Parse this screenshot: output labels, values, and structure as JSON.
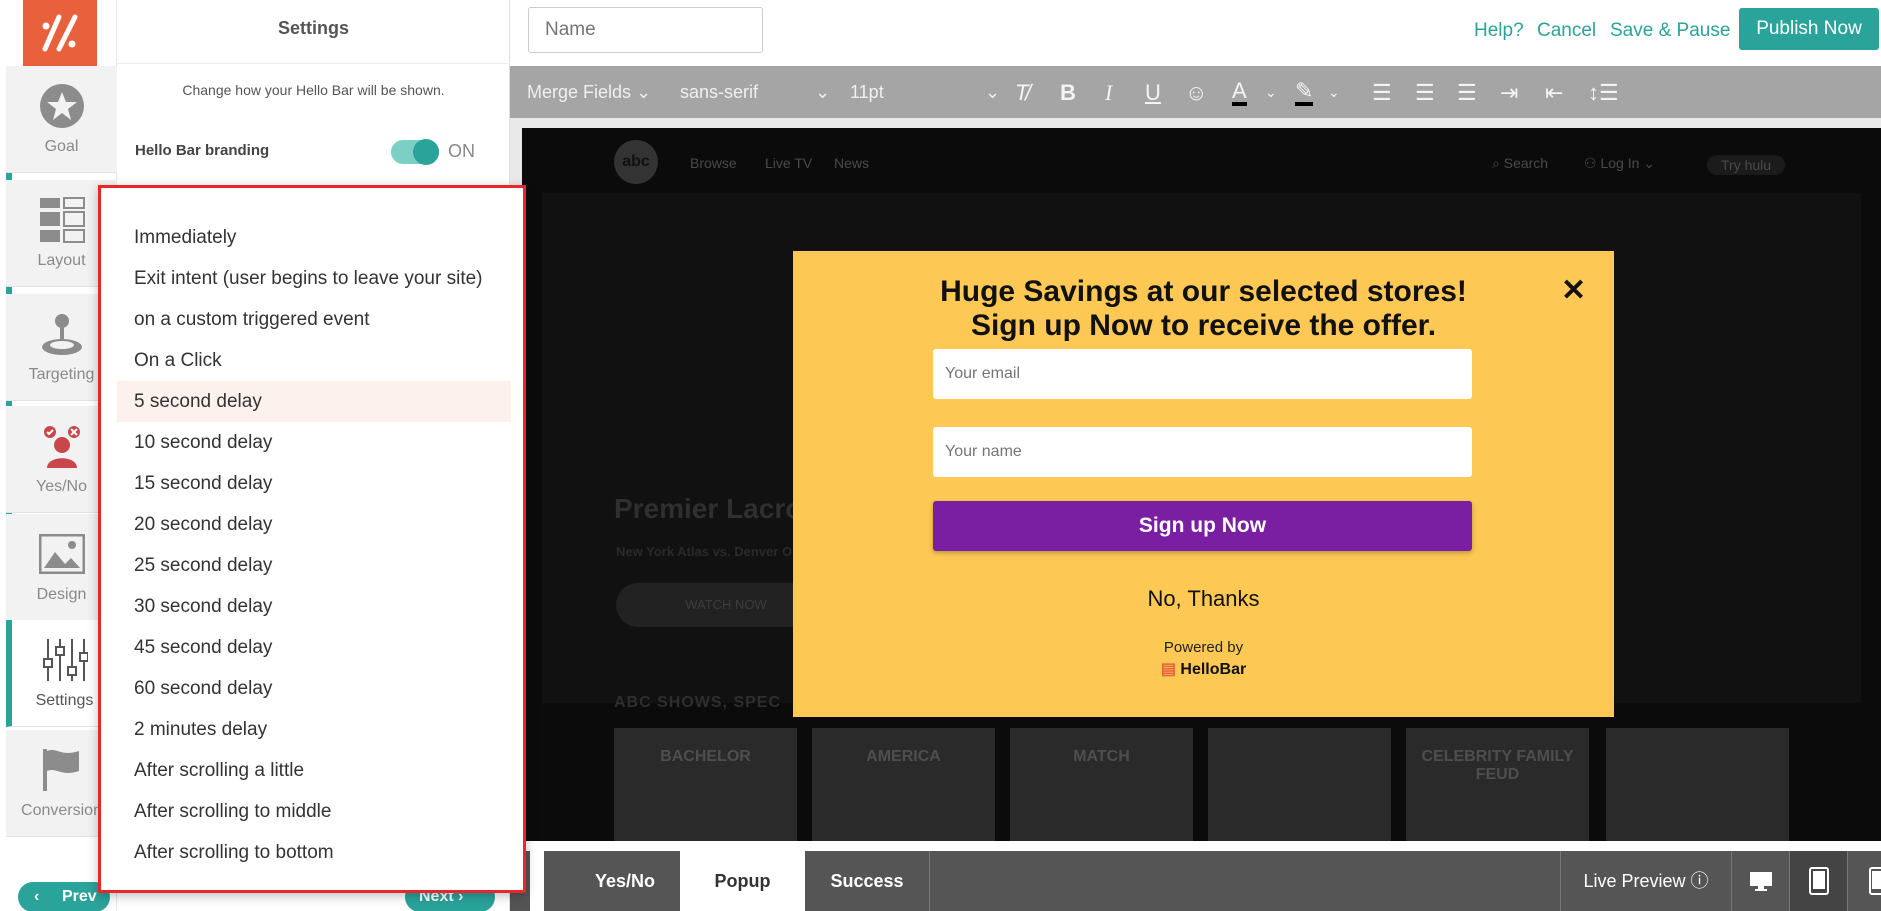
{
  "nav": {
    "items": [
      {
        "label": "Goal",
        "icon": "star-icon"
      },
      {
        "label": "Layout",
        "icon": "layout-icon"
      },
      {
        "label": "Targeting",
        "icon": "joystick-icon"
      },
      {
        "label": "Yes/No",
        "icon": "yes-no-icon"
      },
      {
        "label": "Design",
        "icon": "image-icon"
      },
      {
        "label": "Settings",
        "icon": "sliders-icon"
      },
      {
        "label": "Conversion",
        "icon": "flag-icon"
      }
    ],
    "active": "Settings"
  },
  "panel": {
    "title": "Settings",
    "subtitle": "Change how your Hello Bar will be shown.",
    "branding_label": "Hello Bar branding",
    "branding_state": "ON",
    "prev_label": "Prev",
    "next_label": "Next"
  },
  "dropdown": {
    "options": [
      "Immediately",
      "Exit intent (user begins to leave your site)",
      "on a custom triggered event",
      "On a Click",
      "5 second delay",
      "10 second delay",
      "15 second delay",
      "20 second delay",
      "25 second delay",
      "30 second delay",
      "45 second delay",
      "60 second delay",
      "2 minutes delay",
      "After scrolling a little",
      "After scrolling to middle",
      "After scrolling to bottom"
    ],
    "selected": "5 second delay"
  },
  "topbar": {
    "name_placeholder": "Name",
    "help": "Help?",
    "cancel": "Cancel",
    "save_pause": "Save & Pause",
    "publish": "Publish Now"
  },
  "toolbar": {
    "merge_fields": "Merge Fields",
    "font": "sans-serif",
    "size": "11pt"
  },
  "site": {
    "logo": "abc",
    "nav": [
      "Browse",
      "Live TV",
      "News"
    ],
    "search": "Search",
    "login": "Log In",
    "try": "Try hulu",
    "hero_title": "Premier Lacro",
    "hero_sub": "New York Atlas vs. Denver O",
    "watch": "WATCH NOW",
    "shows_title": "ABC SHOWS, SPEC",
    "thumbs": [
      "BACHELOR",
      "AMERICA",
      "MATCH",
      "",
      "CELEBRITY FAMILY FEUD",
      ""
    ]
  },
  "modal": {
    "headline_1": "Huge Savings at our selected stores!",
    "headline_2": "Sign up Now to receive the offer.",
    "email_placeholder": "Your email",
    "name_placeholder": "Your name",
    "submit": "Sign up Now",
    "no_thanks": "No, Thanks",
    "powered_by": "Powered by",
    "brand": "HelloBar",
    "bg_color": "#fdc853",
    "button_color": "#7b1fa2"
  },
  "bottom": {
    "tabs": [
      "Yes/No",
      "Popup",
      "Success"
    ],
    "active_tab": "Popup",
    "live_preview": "Live Preview",
    "devices": [
      "desktop-icon",
      "tablet-icon",
      "mobile-icon"
    ]
  },
  "colors": {
    "accent": "#2aa39a",
    "logo_bg": "#e8603c",
    "highlight_border": "#e8262b"
  }
}
